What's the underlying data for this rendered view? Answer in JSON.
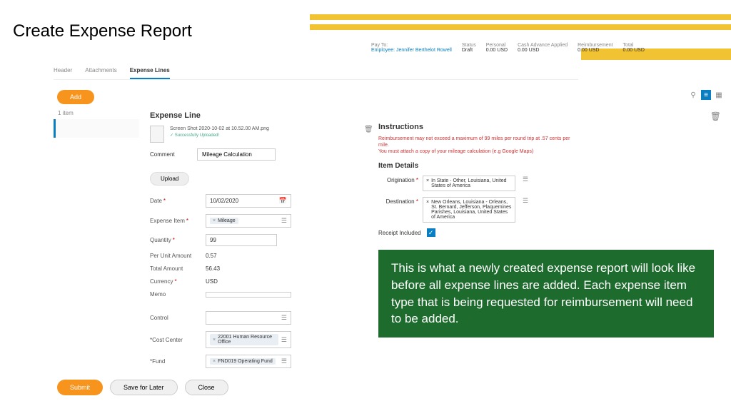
{
  "page_title": "Create Expense Report",
  "summary": {
    "payto_lbl": "Pay To:",
    "payto_val": "Employee: Jennifer Berthelot Rowell",
    "status_lbl": "Status",
    "status_val": "Draft",
    "personal_lbl": "Personal",
    "personal_val": "0.00 USD",
    "cash_lbl": "Cash Advance Applied",
    "cash_val": "0.00 USD",
    "reimb_lbl": "Reimbursement",
    "reimb_val": "0.00 USD",
    "total_lbl": "Total",
    "total_val": "0.00 USD"
  },
  "tabs": {
    "header": "Header",
    "attachments": "Attachments",
    "lines": "Expense Lines"
  },
  "add_label": "Add",
  "item_count": "1 item",
  "section_title": "Expense Line",
  "attachment": {
    "name": "Screen Shot 2020-10-02 at 10.52.00 AM.png",
    "status": "✓ Successfully Uploaded!"
  },
  "comment_lbl": "Comment",
  "comment_val": "Mileage Calculation",
  "upload_label": "Upload",
  "fields": {
    "date_lbl": "Date",
    "date_val": "10/02/2020",
    "item_lbl": "Expense Item",
    "item_val": "Mileage",
    "qty_lbl": "Quantity",
    "qty_val": "99",
    "unit_lbl": "Per Unit Amount",
    "unit_val": "0.57",
    "total_lbl": "Total Amount",
    "total_val": "56.43",
    "curr_lbl": "Currency",
    "curr_val": "USD",
    "memo_lbl": "Memo",
    "control_lbl": "Control",
    "cc_lbl": "*Cost Center",
    "cc_val": "22001 Human Resource Office",
    "fund_lbl": "*Fund",
    "fund_val": "FND019 Operating Fund"
  },
  "instr": {
    "title": "Instructions",
    "warn1": "Reimbursement may not exceed a maximum of 99 miles per round trip at .57 cents per mile.",
    "warn2": "You must attach a copy of your mileage calculation (e.g Google Maps)",
    "details_title": "Item Details",
    "orig_lbl": "Origination",
    "orig_val": "In State - Other, Louisiana, United States of America",
    "dest_lbl": "Destination",
    "dest_val": "New Orleans, Louisiana - Orleans, St. Bernard, Jefferson, Plaquemines Parishes, Louisiana, United States of America",
    "receipt_lbl": "Receipt Included"
  },
  "callout": "This is what a newly created expense report will look like before all expense lines are added. Each expense item type that is being requested for reimbursement will need to be added.",
  "footer": {
    "submit": "Submit",
    "save": "Save for Later",
    "close": "Close"
  }
}
